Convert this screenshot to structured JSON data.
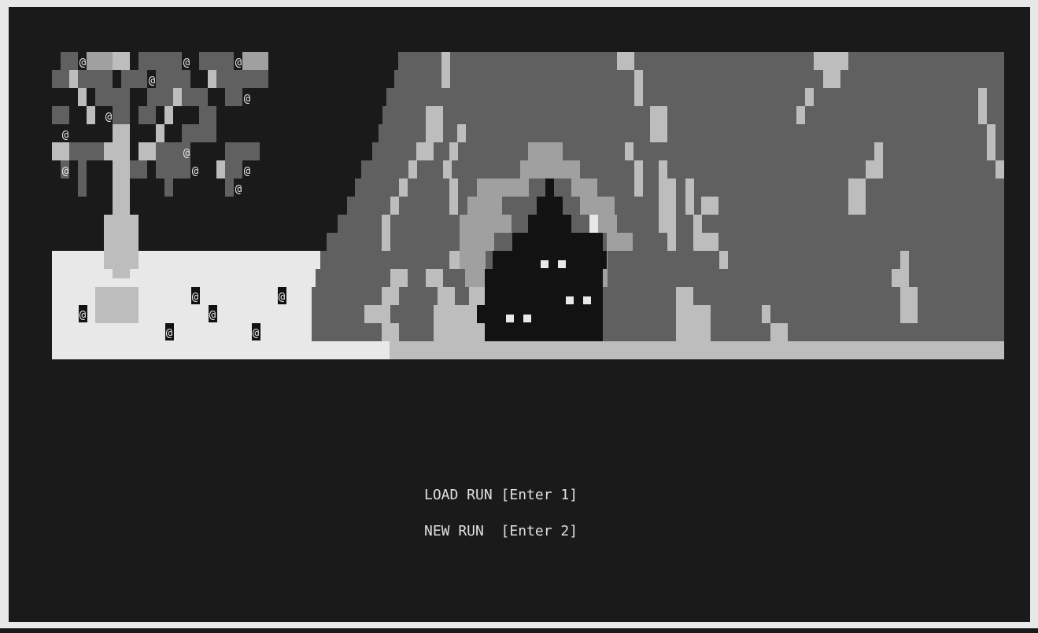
{
  "palette": {
    "background": "#1a1a1a",
    "snow": "#e8e8e8",
    "light": "#bdbdbd",
    "mid": "#a0a0a0",
    "dark": "#606060",
    "cave": "#121212",
    "eye": "#e8e8e8",
    "text": "#e0e0e0"
  },
  "scene": {
    "glyph": "@",
    "creature_glyph": "@"
  },
  "menu": {
    "load_run": "LOAD RUN [Enter 1]",
    "new_run": "NEW RUN  [Enter 2]"
  }
}
